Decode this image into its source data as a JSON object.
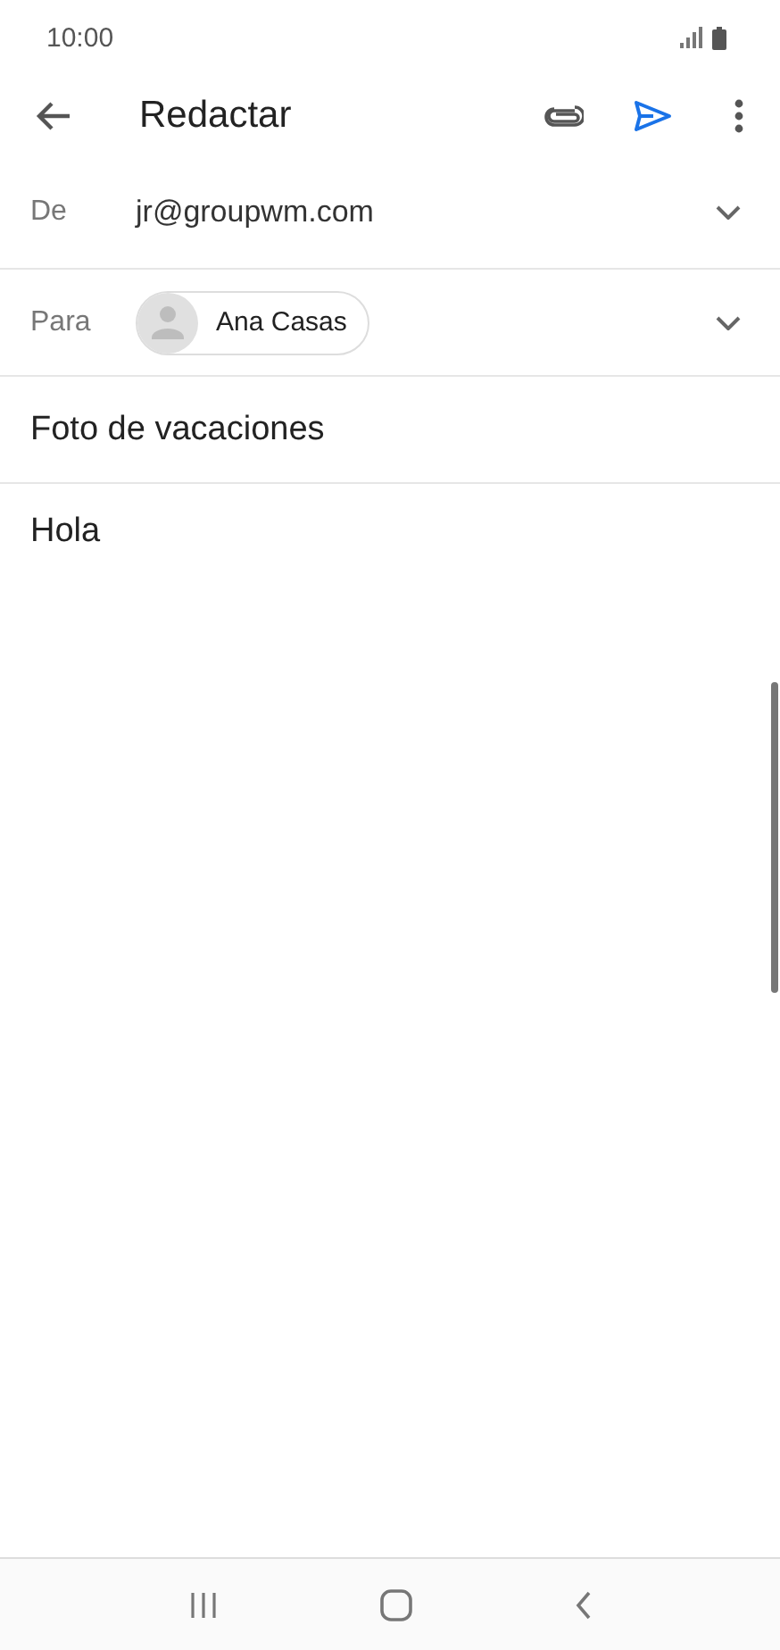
{
  "status_bar": {
    "time": "10:00"
  },
  "toolbar": {
    "title": "Redactar"
  },
  "from": {
    "label": "De",
    "value": "jr@groupwm.com"
  },
  "to": {
    "label": "Para",
    "recipients": [
      {
        "name": "Ana Casas"
      }
    ]
  },
  "subject": {
    "value": "Foto de vacaciones"
  },
  "body": {
    "value": "Hola"
  }
}
